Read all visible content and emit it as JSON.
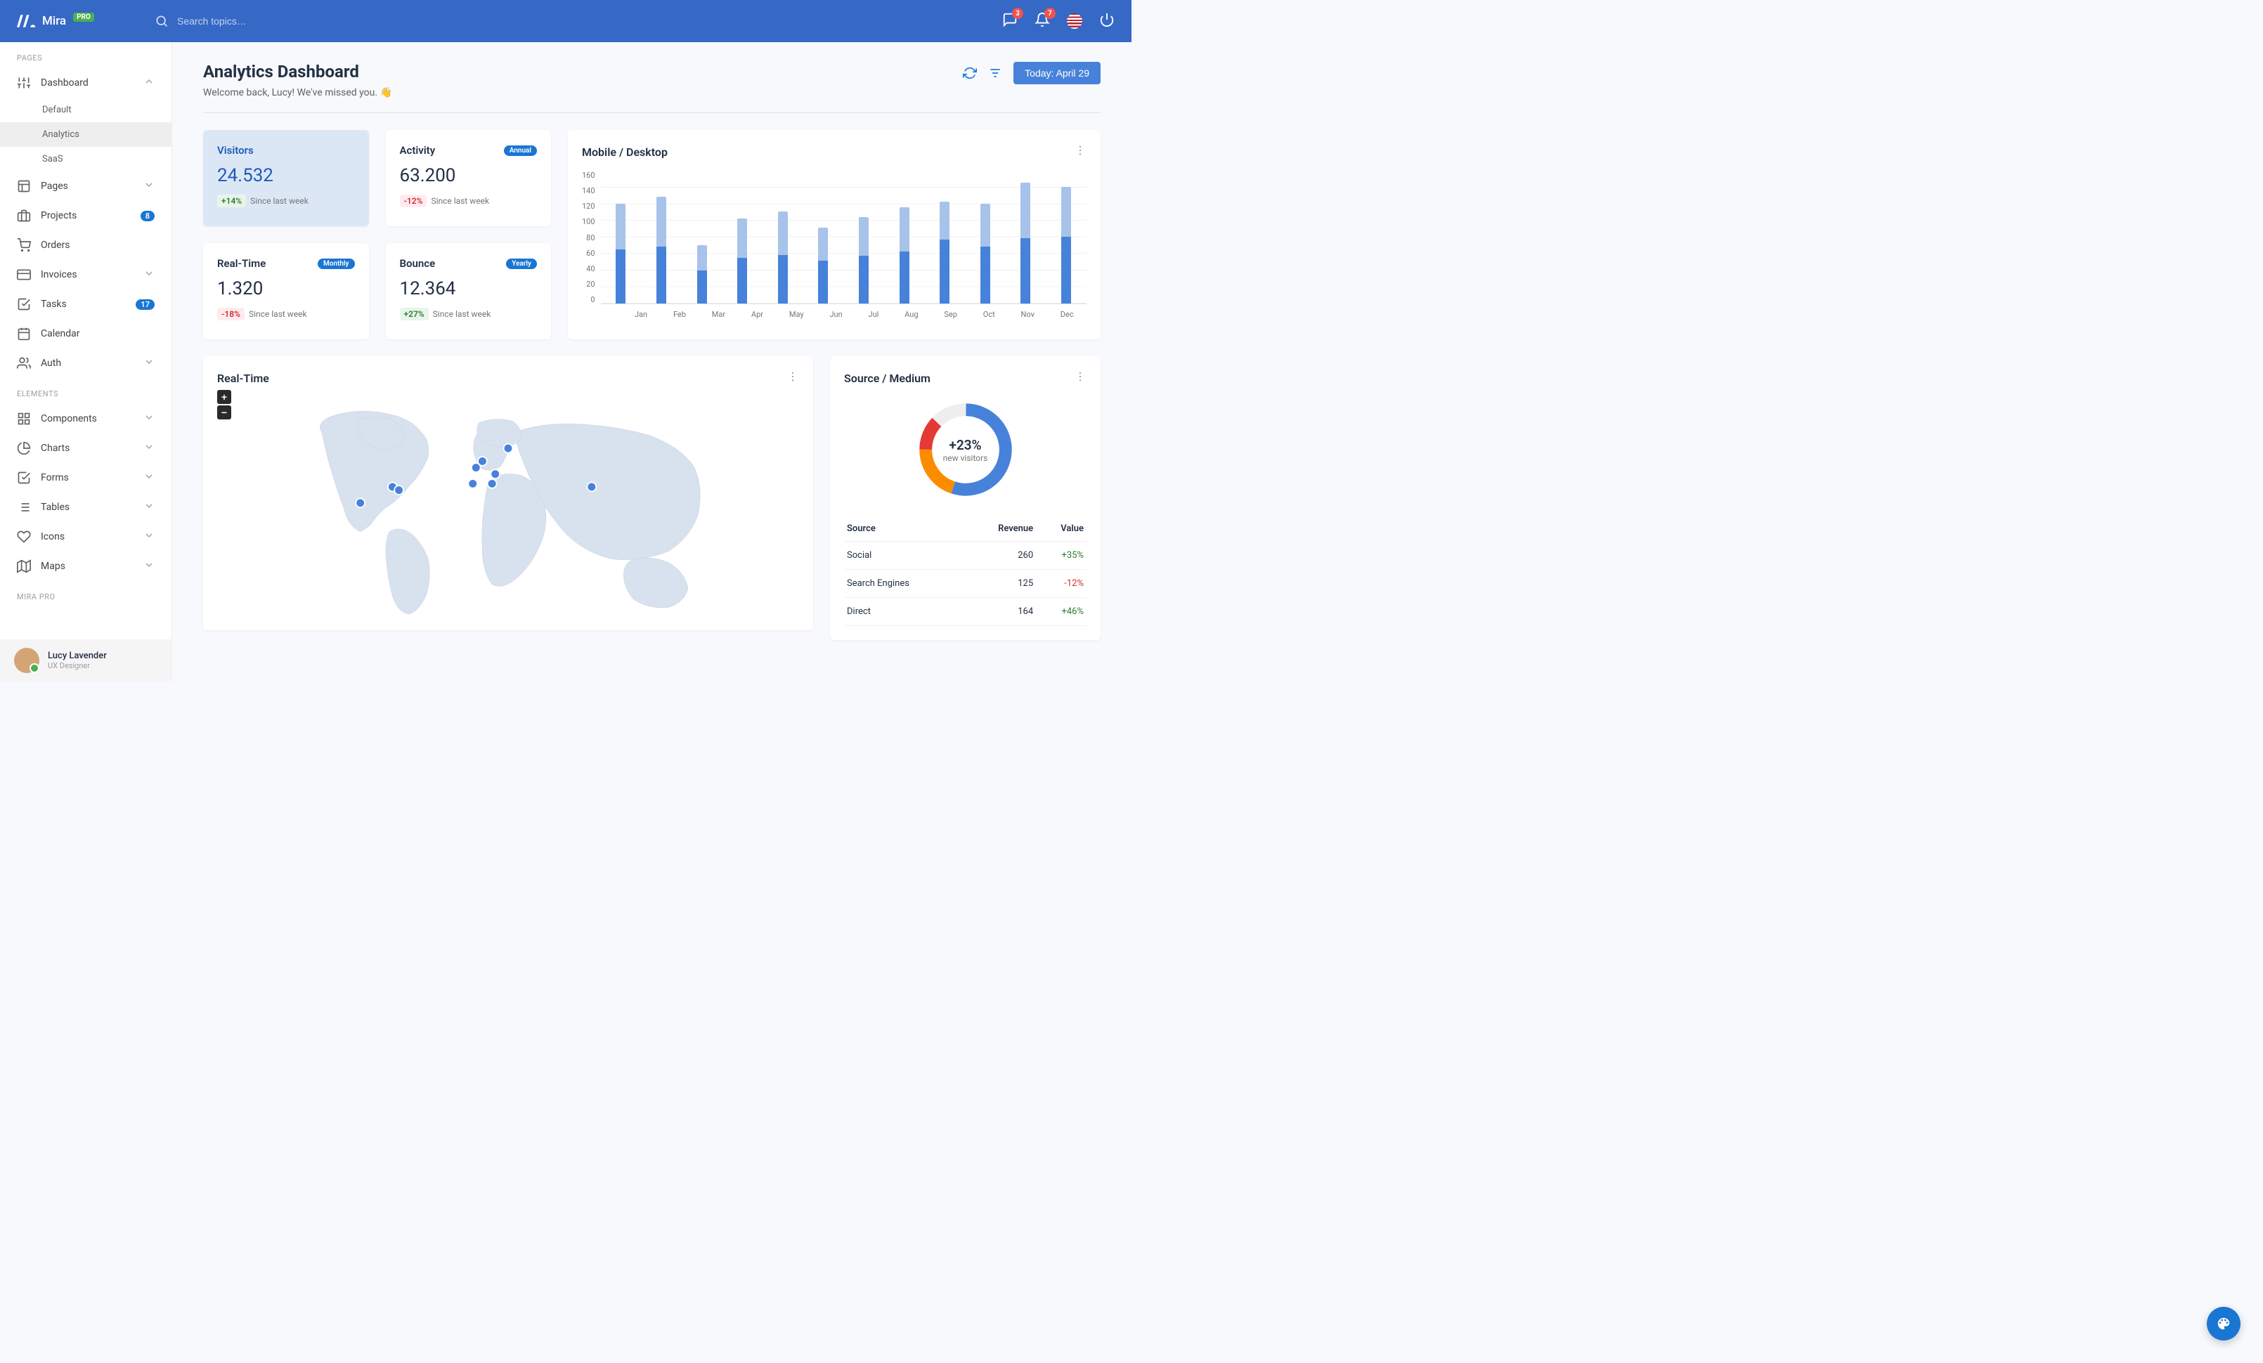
{
  "app": {
    "name": "Mira",
    "badge": "PRO"
  },
  "search": {
    "placeholder": "Search topics…"
  },
  "topbar": {
    "messages_count": "3",
    "notifications_count": "7"
  },
  "sidebar": {
    "section_pages": "PAGES",
    "section_elements": "ELEMENTS",
    "section_pro": "MIRA PRO",
    "dashboard": {
      "label": "Dashboard",
      "children": {
        "default": "Default",
        "analytics": "Analytics",
        "saas": "SaaS"
      }
    },
    "pages": "Pages",
    "projects": {
      "label": "Projects",
      "count": "8"
    },
    "orders": "Orders",
    "invoices": "Invoices",
    "tasks": {
      "label": "Tasks",
      "count": "17"
    },
    "calendar": "Calendar",
    "auth": "Auth",
    "components": "Components",
    "charts": "Charts",
    "forms": "Forms",
    "tables": "Tables",
    "icons": "Icons",
    "maps": "Maps"
  },
  "user": {
    "name": "Lucy Lavender",
    "role": "UX Designer"
  },
  "page": {
    "title": "Analytics Dashboard",
    "subtitle": "Welcome back, Lucy! We've missed you. 👋",
    "date_button": "Today: April 29"
  },
  "stats": {
    "visitors": {
      "title": "Visitors",
      "value": "24.532",
      "delta": "+14%",
      "since": "Since last week"
    },
    "activity": {
      "title": "Activity",
      "pill": "Annual",
      "value": "63.200",
      "delta": "-12%",
      "since": "Since last week"
    },
    "realtime": {
      "title": "Real-Time",
      "pill": "Monthly",
      "value": "1.320",
      "delta": "-18%",
      "since": "Since last week"
    },
    "bounce": {
      "title": "Bounce",
      "pill": "Yearly",
      "value": "12.364",
      "delta": "+27%",
      "since": "Since last week"
    }
  },
  "chart_data": {
    "type": "bar",
    "title": "Mobile / Desktop",
    "categories": [
      "Jan",
      "Feb",
      "Mar",
      "Apr",
      "May",
      "Jun",
      "Jul",
      "Aug",
      "Sep",
      "Oct",
      "Nov",
      "Dec"
    ],
    "series": [
      {
        "name": "Desktop",
        "values": [
          65,
          68,
          40,
          55,
          58,
          51,
          57,
          62,
          77,
          68,
          78,
          80
        ]
      },
      {
        "name": "Mobile",
        "values": [
          120,
          128,
          70,
          102,
          110,
          91,
          104,
          115,
          122,
          120,
          145,
          140
        ]
      }
    ],
    "ylabel": "",
    "xlabel": "",
    "ylim": [
      0,
      160
    ],
    "y_ticks": [
      "160",
      "140",
      "120",
      "100",
      "80",
      "60",
      "40",
      "20",
      "0"
    ]
  },
  "realtime_map": {
    "title": "Real-Time"
  },
  "source_medium": {
    "title": "Source / Medium",
    "center_pct": "+23%",
    "center_sub": "new visitors",
    "columns": {
      "source": "Source",
      "revenue": "Revenue",
      "value": "Value"
    },
    "rows": [
      {
        "source": "Social",
        "revenue": "260",
        "value": "+35%",
        "dir": "pos"
      },
      {
        "source": "Search Engines",
        "revenue": "125",
        "value": "-12%",
        "dir": "neg"
      },
      {
        "source": "Direct",
        "revenue": "164",
        "value": "+46%",
        "dir": "pos"
      }
    ],
    "donut": [
      {
        "color": "#4782da",
        "pct": 55
      },
      {
        "color": "#fb8c00",
        "pct": 20
      },
      {
        "color": "#e53935",
        "pct": 12
      },
      {
        "color": "#eeeeee",
        "pct": 13
      }
    ]
  }
}
